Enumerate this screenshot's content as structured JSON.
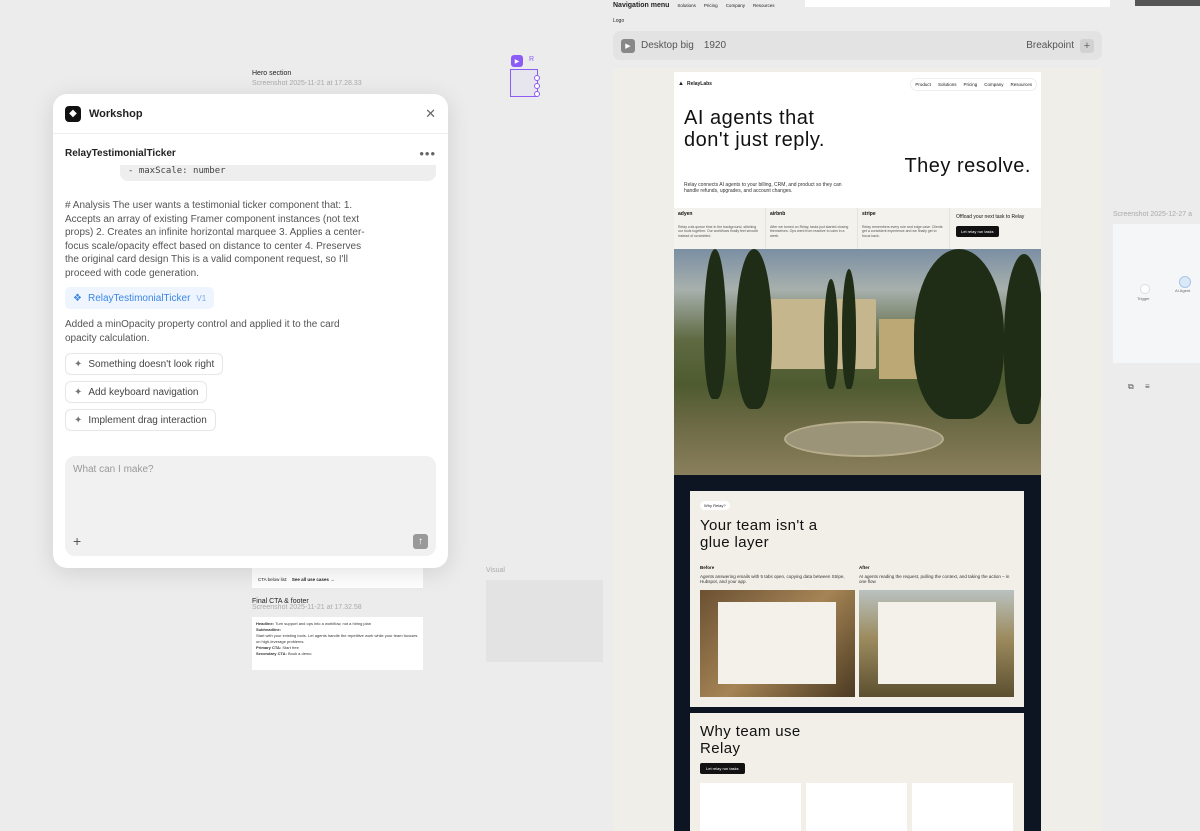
{
  "canvas": {
    "nav_menu_label": "Navigation menu",
    "nav_menu_links": [
      "Solutions",
      "Pricing",
      "Company",
      "Resources"
    ],
    "logo_label": "Logo",
    "hero_section_label": "Hero section",
    "hero_section_screenshot": "Screenshot 2025-11-21 at 17.28.33",
    "final_cta_label": "Final CTA & footer",
    "final_cta_screenshot": "Screenshot 2025-11-21 at 17.32.58",
    "visual_label": "Visual",
    "right_screenshot_label": "Screenshot 2025-12-27 a",
    "cta_below_list": "CTA below list:",
    "see_all_use_cases": "See all use cases →",
    "final_cta_lines": {
      "headline_label": "Headline:",
      "headline": "Turn support and ops into a workflow, not a hiring plan",
      "subheadline_label": "Subheadline:",
      "subheadline": "Start with your existing tools. Let agents handle the repetitive work while your team focuses on high-leverage problems.",
      "primary_label": "Primary CTA:",
      "primary": "Start free",
      "secondary_label": "Secondary CTA:",
      "secondary": "Book a demo"
    },
    "component_node_label": "R",
    "right_thumb_labels": [
      "Trigger",
      "AI Agent"
    ]
  },
  "workshop": {
    "title": "Workshop",
    "component_name": "RelayTestimonialTicker",
    "code_snippet": "- maxScale: number",
    "analysis": "# Analysis The user wants a testimonial ticker component that: 1. Accepts an array of existing Framer component instances (not text props) 2. Creates an infinite horizontal marquee 3. Applies a center-focus scale/opacity effect based on distance to center 4. Preserves the original card design This is a valid component request, so I'll proceed with code generation.",
    "component_link": "RelayTestimonialTicker",
    "component_version": "V1",
    "result_message": "Added a minOpacity property control and applied it to the card opacity calculation.",
    "suggestions": [
      "Something doesn't look right",
      "Add keyboard navigation",
      "Implement drag interaction"
    ],
    "input_placeholder": "What can I make?"
  },
  "frame": {
    "name": "Desktop big",
    "width": "1920",
    "breakpoint_label": "Breakpoint"
  },
  "site": {
    "brand": "RelayLabs",
    "nav": [
      "Product",
      "Solutions",
      "Pricing",
      "Company",
      "Resources"
    ],
    "hero_line1": "AI agents that",
    "hero_line2": "don't just reply.",
    "hero_line3": "They resolve.",
    "hero_sub": "Relay connects AI agents to your billing, CRM, and product so they can handle refunds, upgrades, and account changes.",
    "testimonials": [
      {
        "company": "adyen",
        "quote": "Relay cuts queue time in the background, stitching our tools together. Our workflows finally feel smooth instead of scrambled."
      },
      {
        "company": "airbnb",
        "quote": "After we turned on Relay, tasks just started closing themselves. Ops went from reactive to calm in a week."
      },
      {
        "company": "stripe",
        "quote": "Relay remembers every rule and edge case. Clients get a consistent experience and we finally get to focus back."
      }
    ],
    "testimonial_cta_text": "Offload your next task to Relay",
    "testimonial_cta_btn": "Let relay run tasks",
    "why_tag": "Why Relay?",
    "card1_title": "Your team isn't a glue layer",
    "before_label": "Before",
    "before_text": "Agents answering emails with 5 tabs open, copying data between Stripe, Hubspot, and your app.",
    "after_label": "After",
    "after_text": "AI agents reading the request, pulling the context, and taking the action – in one flow",
    "card2_title": "Why team use Relay",
    "card2_btn": "Let relay run tasks"
  }
}
